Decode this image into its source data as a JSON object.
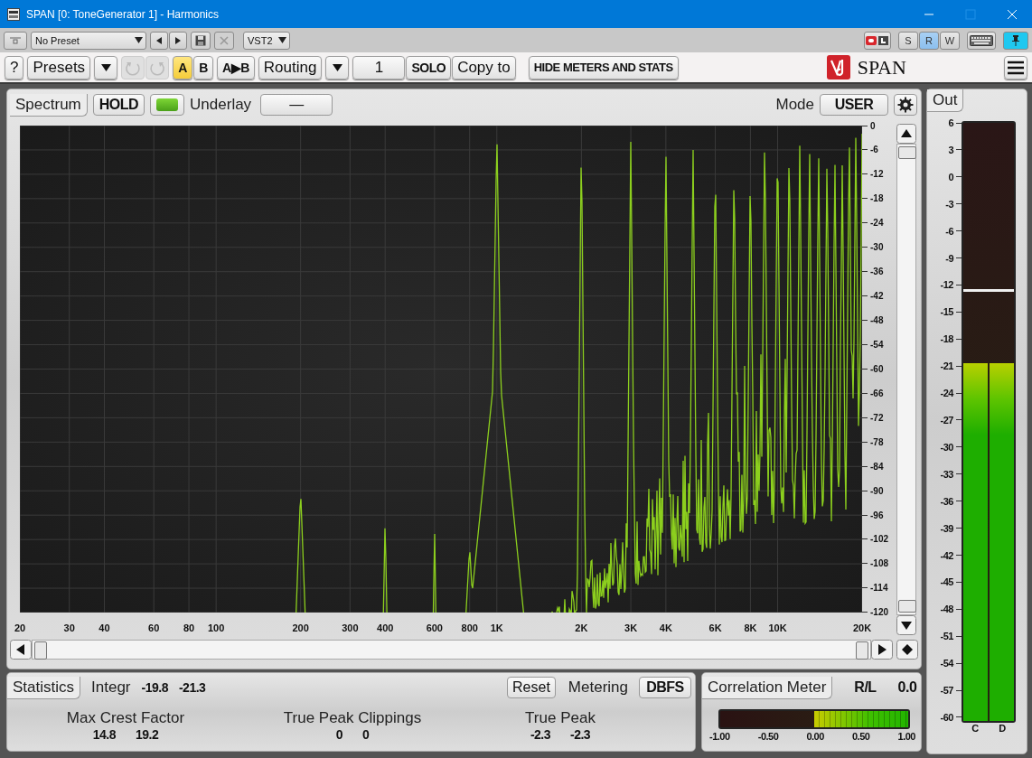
{
  "window": {
    "title": "SPAN [0: ToneGenerator 1] - Harmonics"
  },
  "host_toolbar": {
    "preset": "No Preset",
    "format": "VST2",
    "modes": [
      {
        "label": "S",
        "selected": false
      },
      {
        "label": "R",
        "selected": true
      },
      {
        "label": "W",
        "selected": false
      }
    ],
    "pin": {
      "on": true
    }
  },
  "toolbar": {
    "help": "?",
    "presets": "Presets",
    "undo": {
      "disabled": true
    },
    "redo": {
      "disabled": true
    },
    "ab": [
      {
        "label": "A",
        "selected": true
      },
      {
        "label": "B",
        "selected": false
      }
    ],
    "copy_ab": "A▶B",
    "routing": "Routing",
    "channel": "1",
    "solo": "SOLO",
    "copy_to": "Copy to",
    "hide": "HIDE METERS AND STATS",
    "brand": "SPAN"
  },
  "spectrum": {
    "tab": "Spectrum",
    "hold": "HOLD",
    "indicator": {
      "on": true
    },
    "underlay_label": "Underlay",
    "underlay": "—",
    "mode_label": "Mode",
    "mode": "USER",
    "y_labels": [
      "0",
      "-6",
      "-12",
      "-18",
      "-24",
      "-30",
      "-36",
      "-42",
      "-48",
      "-54",
      "-60",
      "-66",
      "-72",
      "-78",
      "-84",
      "-90",
      "-96",
      "-102",
      "-108",
      "-114",
      "-120"
    ],
    "x_labels": [
      "20",
      "30",
      "40",
      "60",
      "80",
      "100",
      "200",
      "300",
      "400",
      "600",
      "800",
      "1K",
      "2K",
      "3K",
      "4K",
      "6K",
      "8K",
      "10K",
      "20K"
    ]
  },
  "out_meter": {
    "tab": "Out",
    "scale": [
      "6",
      "3",
      "0",
      "-3",
      "-6",
      "-9",
      "-12",
      "-15",
      "-18",
      "-21",
      "-24",
      "-27",
      "-30",
      "-33",
      "-36",
      "-39",
      "-42",
      "-45",
      "-48",
      "-51",
      "-54",
      "-57",
      "-60"
    ],
    "channels": [
      {
        "label": "C",
        "level": 0.598
      },
      {
        "label": "D",
        "level": 0.598
      }
    ],
    "peak_hold": {
      "level": 0.717
    }
  },
  "statistics": {
    "tab": "Statistics",
    "integr_label": "Integr",
    "integr": [
      "-19.8",
      "-21.3"
    ],
    "reset": "Reset",
    "metering_label": "Metering",
    "metering": "DBFS",
    "groups": [
      {
        "label": "Max Crest Factor",
        "values": [
          "14.8",
          "19.2"
        ]
      },
      {
        "label": "True Peak Clippings",
        "values": [
          "0",
          "0"
        ]
      },
      {
        "label": "True Peak",
        "values": [
          "-2.3",
          "-2.3"
        ]
      }
    ]
  },
  "correlation": {
    "tab": "Correlation Meter",
    "channel": "R/L",
    "value": "0.0",
    "scale": [
      "-1.00",
      "-0.50",
      "0.00",
      "0.50",
      "1.00"
    ]
  }
}
